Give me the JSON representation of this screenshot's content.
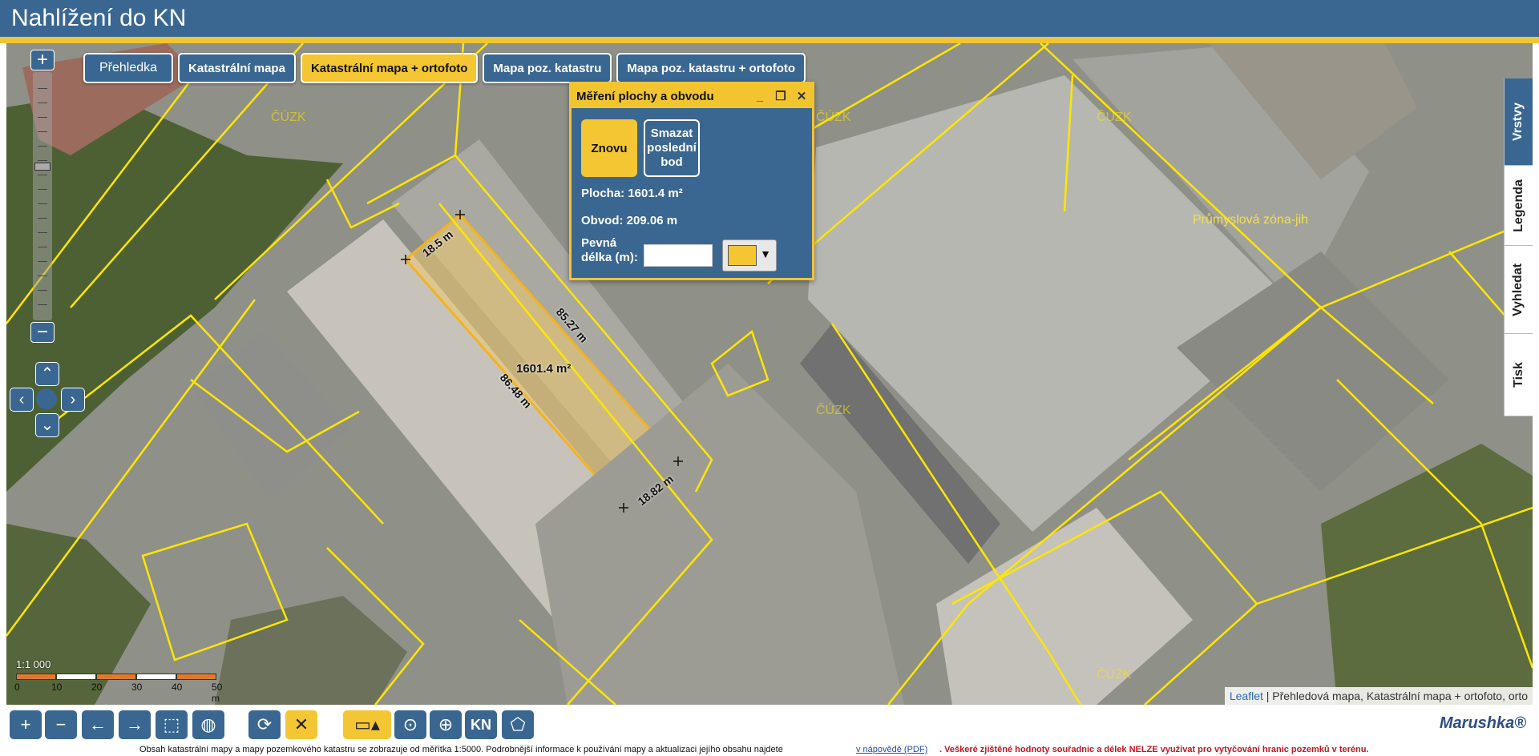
{
  "header": {
    "title": "Nahlížení do KN"
  },
  "layer_tabs": [
    {
      "label": "Přehledka"
    },
    {
      "label": "Katastrální mapa"
    },
    {
      "label": "Katastrální mapa + ortofoto"
    },
    {
      "label": "Mapa poz. katastru"
    },
    {
      "label": "Mapa poz. katastru + ortofoto"
    }
  ],
  "zoom": {
    "in_label": "+",
    "out_label": "−"
  },
  "map_labels": {
    "zone": "Průmyslová zóna-jih",
    "cuzk": "ČÚZK",
    "dim_top": "18.5 m",
    "dim_right": "85.27 m",
    "dim_left": "86.48 m",
    "dim_bottom": "18.82 m",
    "area": "1601.4 m²"
  },
  "measure": {
    "title": "Měření plochy a obvodu",
    "minimize": "_",
    "maximize": "❐",
    "close": "✕",
    "again_button": "Znovu",
    "delete_last_line1": "Smazat",
    "delete_last_line2": "poslední",
    "delete_last_line3": "bod",
    "area_text": "Plocha: 1601.4 m²",
    "perimeter_text": "Obvod: 209.06 m",
    "fixed_length_line1": "Pevná",
    "fixed_length_line2": "délka (m):",
    "fixed_length_value": "",
    "color_arrow": "▼",
    "color": "#f4c634"
  },
  "side_tabs": [
    "Vrstvy",
    "Legenda",
    "Vyhledat",
    "Tisk"
  ],
  "scale": {
    "ratio": "1:1 000",
    "ticks": [
      "0",
      "10",
      "20",
      "30",
      "40",
      "50 m"
    ]
  },
  "attribution": {
    "link": "Leaflet",
    "text": " | Přehledová mapa, Katastrální mapa + ortofoto, orto"
  },
  "toolbar": {
    "brand": "Marushka®",
    "kn_label": "KN"
  },
  "footer": {
    "info": "Obsah katastrální mapy a mapy pozemkového katastru se zobrazuje od měřítka 1:5000. Podrobnější informace k používání mapy a aktualizaci jejího obsahu najdete",
    "help_link": "v nápovědě (PDF)",
    "warning": ". Veškeré zjištěné hodnoty souřadnic a délek NELZE využívat pro vytyčování hranic pozemků v terénu."
  },
  "colors": {
    "header": "#3a6792",
    "accent": "#f2c530",
    "parcel_line": "#ffe600"
  }
}
